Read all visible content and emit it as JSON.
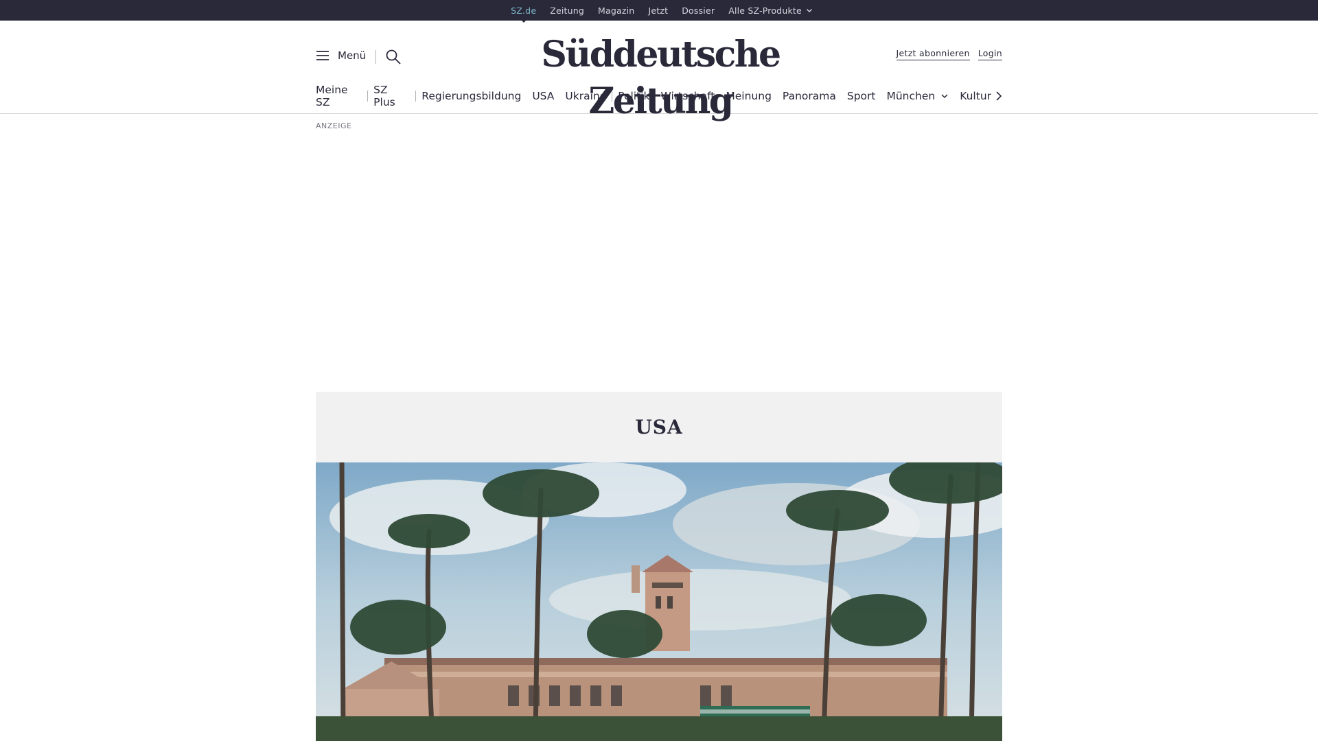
{
  "topbar": {
    "items": [
      {
        "label": "SZ.de",
        "active": true
      },
      {
        "label": "Zeitung"
      },
      {
        "label": "Magazin"
      },
      {
        "label": "Jetzt"
      },
      {
        "label": "Dossier"
      },
      {
        "label": "Alle SZ-Produkte"
      }
    ]
  },
  "header": {
    "menu_label": "Menü",
    "logo": "Süddeutsche Zeitung",
    "subscribe_label": "Jetzt abonnieren",
    "login_label": "Login"
  },
  "section_nav": {
    "items": [
      "Meine SZ",
      "SZ Plus",
      "Regierungsbildung",
      "USA",
      "Ukraine",
      "Politik",
      "Wirtschaft",
      "Meinung",
      "Panorama",
      "Sport",
      "München",
      "Kultur"
    ]
  },
  "ad": {
    "label": "ANZEIGE"
  },
  "ressort": {
    "title": "USA"
  },
  "colors": {
    "topbar_bg": "#29293a",
    "active_link": "#7fb7cc",
    "text": "#29293a",
    "ressort_bg": "#f1f1f1"
  },
  "icons": {
    "menu": "hamburger-icon",
    "search": "search-icon",
    "dropdown": "chevron-down-icon",
    "scroll": "chevron-right-icon"
  }
}
